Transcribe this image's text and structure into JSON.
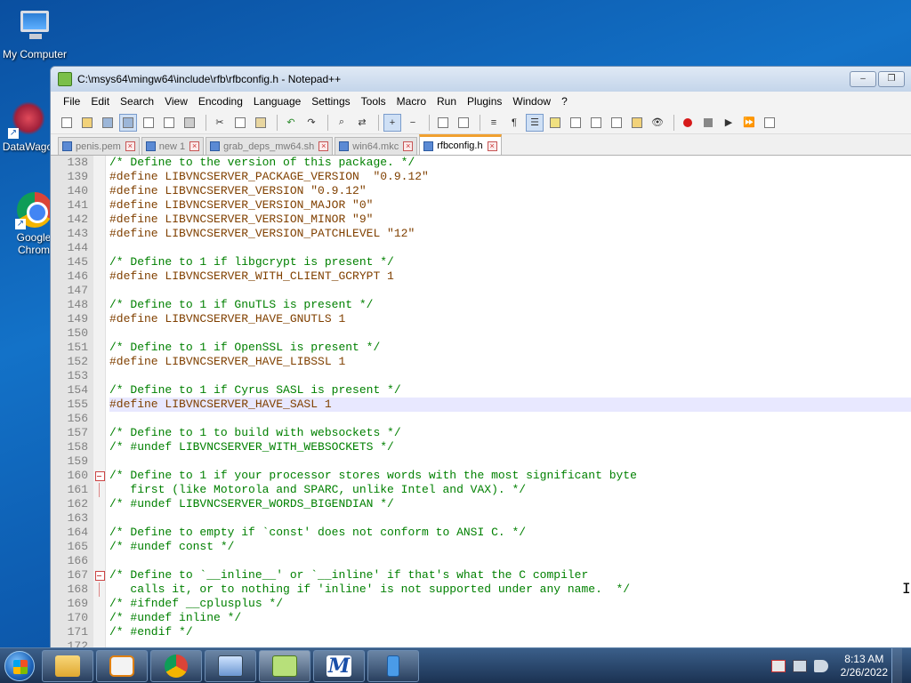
{
  "desktop": {
    "icons": [
      {
        "label": "My Computer"
      },
      {
        "label": "DataWago"
      },
      {
        "label": "Google Chrom"
      }
    ]
  },
  "window": {
    "title": "C:\\msys64\\mingw64\\include\\rfb\\rfbconfig.h - Notepad++",
    "controls": {
      "minimize": "–",
      "restore": "❐"
    }
  },
  "menu": [
    "File",
    "Edit",
    "Search",
    "View",
    "Encoding",
    "Language",
    "Settings",
    "Tools",
    "Macro",
    "Run",
    "Plugins",
    "Window",
    "?"
  ],
  "tabs": [
    {
      "label": "penis.pem",
      "active": false
    },
    {
      "label": "new 1",
      "active": false
    },
    {
      "label": "grab_deps_mw64.sh",
      "active": false
    },
    {
      "label": "win64.mkc",
      "active": false
    },
    {
      "label": "rfbconfig.h",
      "active": true
    }
  ],
  "editor": {
    "lines": [
      {
        "n": "138",
        "t": "/* Define to the version of this package. */"
      },
      {
        "n": "139",
        "t": "#define LIBVNCSERVER_PACKAGE_VERSION  \"0.9.12\""
      },
      {
        "n": "140",
        "t": "#define LIBVNCSERVER_VERSION \"0.9.12\""
      },
      {
        "n": "141",
        "t": "#define LIBVNCSERVER_VERSION_MAJOR \"0\""
      },
      {
        "n": "142",
        "t": "#define LIBVNCSERVER_VERSION_MINOR \"9\""
      },
      {
        "n": "143",
        "t": "#define LIBVNCSERVER_VERSION_PATCHLEVEL \"12\""
      },
      {
        "n": "144",
        "t": ""
      },
      {
        "n": "145",
        "t": "/* Define to 1 if libgcrypt is present */"
      },
      {
        "n": "146",
        "t": "#define LIBVNCSERVER_WITH_CLIENT_GCRYPT 1"
      },
      {
        "n": "147",
        "t": ""
      },
      {
        "n": "148",
        "t": "/* Define to 1 if GnuTLS is present */"
      },
      {
        "n": "149",
        "t": "#define LIBVNCSERVER_HAVE_GNUTLS 1"
      },
      {
        "n": "150",
        "t": ""
      },
      {
        "n": "151",
        "t": "/* Define to 1 if OpenSSL is present */"
      },
      {
        "n": "152",
        "t": "#define LIBVNCSERVER_HAVE_LIBSSL 1"
      },
      {
        "n": "153",
        "t": ""
      },
      {
        "n": "154",
        "t": "/* Define to 1 if Cyrus SASL is present */"
      },
      {
        "n": "155",
        "t": "#define LIBVNCSERVER_HAVE_SASL 1"
      },
      {
        "n": "156",
        "t": ""
      },
      {
        "n": "157",
        "t": "/* Define to 1 to build with websockets */"
      },
      {
        "n": "158",
        "t": "/* #undef LIBVNCSERVER_WITH_WEBSOCKETS */"
      },
      {
        "n": "159",
        "t": ""
      },
      {
        "n": "160",
        "t": "/* Define to 1 if your processor stores words with the most significant byte"
      },
      {
        "n": "161",
        "t": "   first (like Motorola and SPARC, unlike Intel and VAX). */"
      },
      {
        "n": "162",
        "t": "/* #undef LIBVNCSERVER_WORDS_BIGENDIAN */"
      },
      {
        "n": "163",
        "t": ""
      },
      {
        "n": "164",
        "t": "/* Define to empty if `const' does not conform to ANSI C. */"
      },
      {
        "n": "165",
        "t": "/* #undef const */"
      },
      {
        "n": "166",
        "t": ""
      },
      {
        "n": "167",
        "t": "/* Define to `__inline__' or `__inline' if that's what the C compiler"
      },
      {
        "n": "168",
        "t": "   calls it, or to nothing if 'inline' is not supported under any name.  */"
      },
      {
        "n": "169",
        "t": "/* #ifndef __cplusplus */"
      },
      {
        "n": "170",
        "t": "/* #undef inline */"
      },
      {
        "n": "171",
        "t": "/* #endif */"
      },
      {
        "n": "172",
        "t": ""
      }
    ]
  },
  "taskbar": {
    "clock_time": "8:13 AM",
    "clock_date": "2/26/2022"
  }
}
